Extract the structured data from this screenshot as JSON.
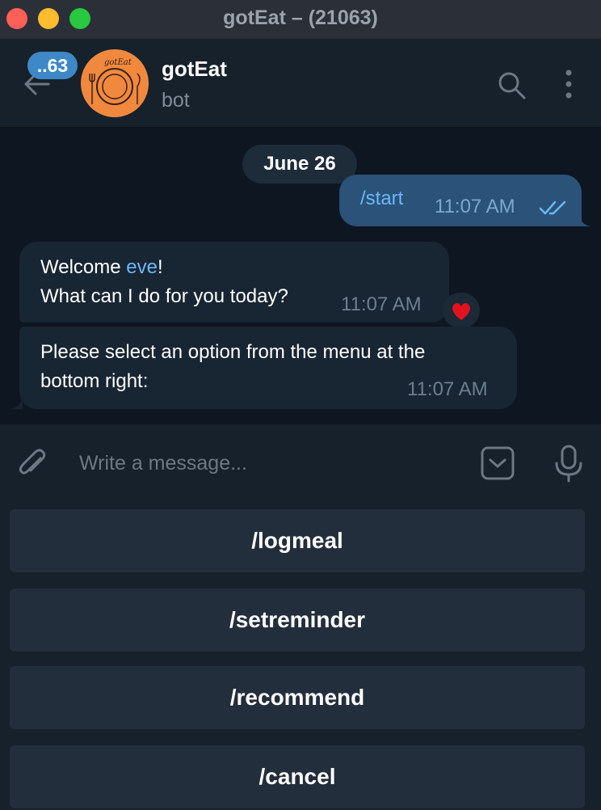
{
  "window": {
    "title": "gotEat – (21063)"
  },
  "header": {
    "unread_count": "..63",
    "chat_name": "gotEat",
    "chat_status": "bot",
    "avatar_logo_text": "gotEat"
  },
  "chat": {
    "date_separator": "June 26",
    "messages": [
      {
        "direction": "outgoing",
        "text": "/start",
        "time": "11:07 AM",
        "status": "read"
      },
      {
        "direction": "incoming",
        "text_before_mention": "Welcome ",
        "mention": "eve",
        "text_after_mention": "!",
        "line2": "What can I do for you today?",
        "time": "11:07 AM",
        "reaction": "red-heart"
      },
      {
        "direction": "incoming",
        "line1": "Please select an option from the menu at the",
        "line2": "bottom right:",
        "time": "11:07 AM"
      }
    ]
  },
  "composer": {
    "placeholder": "Write a message..."
  },
  "bot_keyboard": {
    "buttons": [
      "/logmeal",
      "/setreminder",
      "/recommend",
      "/cancel"
    ]
  },
  "colors": {
    "background": "#0e1621",
    "panel": "#17212b",
    "outgoing_bubble": "#2b5278",
    "incoming_bubble": "#182533",
    "accent": "#6ab8f7",
    "avatar": "#f0893e"
  }
}
